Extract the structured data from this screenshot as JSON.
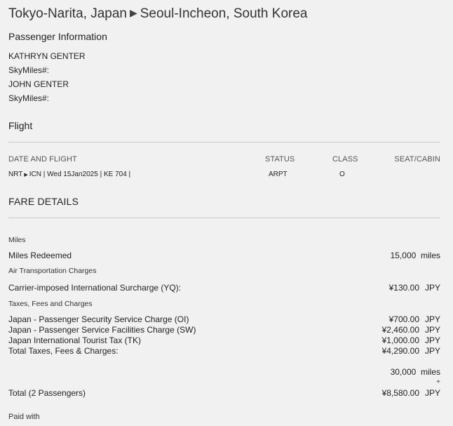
{
  "route": {
    "origin": "Tokyo-Narita, Japan",
    "arrow_icon": "triangle-right-icon",
    "destination": "Seoul-Incheon, South Korea"
  },
  "passenger_info": {
    "heading": "Passenger Information",
    "passengers": [
      {
        "name": "KATHRYN GENTER",
        "skymiles_label": "SkyMiles#:"
      },
      {
        "name": "JOHN GENTER",
        "skymiles_label": "SkyMiles#:"
      }
    ]
  },
  "flight": {
    "heading": "Flight",
    "columns": {
      "date_flight": "DATE AND FLIGHT",
      "status": "STATUS",
      "class": "CLASS",
      "seat": "SEAT/CABIN"
    },
    "row": {
      "from": "NRT",
      "to": "ICN | Wed 15Jan2025 | KE 704 |",
      "status": "ARPT",
      "class": "O",
      "seat": ""
    }
  },
  "fare": {
    "heading": "FARE DETAILS",
    "miles_heading": "Miles",
    "miles_redeemed_label": "Miles Redeemed",
    "miles_redeemed_value": "15,000",
    "miles_unit": "miles",
    "air_transport_heading": "Air Transportation Charges",
    "surcharge_label": "Carrier-imposed International Surcharge (YQ):",
    "surcharge_value": "¥130.00",
    "currency": "JPY",
    "taxes_heading": "Taxes, Fees and Charges",
    "taxes": [
      {
        "label": "Japan - Passenger Security Service Charge (OI)",
        "value": "¥700.00"
      },
      {
        "label": "Japan - Passenger Service Facilities Charge (SW)",
        "value": "¥2,460.00"
      },
      {
        "label": "Japan International Tourist Tax (TK)",
        "value": "¥1,000.00"
      },
      {
        "label": "Total Taxes, Fees & Charges:",
        "value": "¥4,290.00"
      }
    ],
    "total_miles": "30,000",
    "plus": "+",
    "total_label": "Total (2 Passengers)",
    "total_value": "¥8,580.00",
    "paid_with": "Paid with"
  }
}
